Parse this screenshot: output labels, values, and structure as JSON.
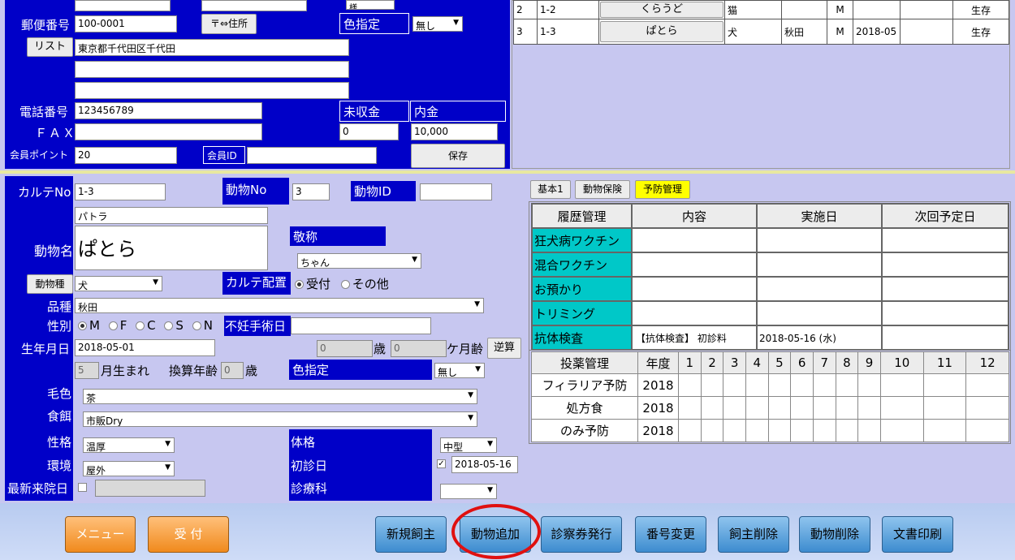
{
  "owner": {
    "postal_label": "郵便番号",
    "postal_value": "100-0001",
    "postal_to_address_button": "〒⇔住所",
    "color_label": "色指定",
    "color_value": "無し",
    "honorific_value_top": "様",
    "list_button": "リスト",
    "address1": "東京都千代田区千代田",
    "address2": "",
    "address3": "",
    "phone_label": "電話番号",
    "phone_value": "123456789",
    "fax_label": "ＦＡＸ",
    "fax_value": "",
    "unpaid_label": "未収金",
    "unpaid_value": "0",
    "deposit_label": "内金",
    "deposit_value": "10,000",
    "points_label": "会員ポイント",
    "points_value": "20",
    "member_id_label": "会員ID",
    "member_id_value": "",
    "save_button": "保存"
  },
  "animal_list": {
    "rows": [
      {
        "num": "2",
        "chart": "1-2",
        "name": "くらうど",
        "species": "猫",
        "breed": "",
        "sex": "M",
        "birth": "",
        "extra": "",
        "status": "生存"
      },
      {
        "num": "3",
        "chart": "1-3",
        "name": "ぱとら",
        "species": "犬",
        "breed": "秋田",
        "sex": "M",
        "birth": "2018-05",
        "extra": "",
        "status": "生存"
      }
    ]
  },
  "animal": {
    "chart_no_label": "カルテNo",
    "chart_no_value": "1-3",
    "animal_no_label": "動物No",
    "animal_no_value": "3",
    "animal_id_label": "動物ID",
    "animal_id_value": "",
    "kana_value": "パトラ",
    "name_label": "動物名",
    "name_value": "ぱとら",
    "honorific_label": "敬称",
    "honorific_value": "ちゃん",
    "species_button": "動物種",
    "species_value": "犬",
    "chart_placement_label": "カルテ配置",
    "placement_options": [
      "受付",
      "その他"
    ],
    "breed_label": "品種",
    "breed_value": "秋田",
    "sex_label": "性別",
    "sex_options": [
      "M",
      "F",
      "C",
      "S",
      "N"
    ],
    "neuter_label": "不妊手術日",
    "neuter_value": "",
    "birth_label": "生年月日",
    "birth_value": "2018-05-01",
    "age_years": "0",
    "age_years_unit": "歳",
    "age_months": "0",
    "age_months_unit": "ケ月齢",
    "calc_button": "逆算",
    "birth_month": "5",
    "birth_month_suffix": "月生まれ",
    "converted_age_label": "換算年齢",
    "converted_age": "0",
    "converted_age_unit": "歳",
    "color_label": "色指定",
    "color_value": "無し",
    "coat_label": "毛色",
    "coat_value": "茶",
    "food_label": "食餌",
    "food_value": "市販Dry",
    "temper_label": "性格",
    "temper_value": "温厚",
    "env_label": "環境",
    "env_value": "屋外",
    "last_visit_label": "最新来院日",
    "last_visit_value": "",
    "build_label": "体格",
    "build_value": "中型",
    "first_visit_label": "初診日",
    "first_visit_value": "2018-05-16",
    "dept_label": "診療科",
    "dept_value": ""
  },
  "tabs": [
    "基本1",
    "動物保険",
    "予防管理"
  ],
  "history": {
    "headers": [
      "履歴管理",
      "内容",
      "実施日",
      "次回予定日"
    ],
    "rows": [
      {
        "name": "狂犬病ワクチン",
        "content": "",
        "date": "",
        "next": ""
      },
      {
        "name": "混合ワクチン",
        "content": "",
        "date": "",
        "next": ""
      },
      {
        "name": "お預かり",
        "content": "",
        "date": "",
        "next": ""
      },
      {
        "name": "トリミング",
        "content": "",
        "date": "",
        "next": ""
      },
      {
        "name": "抗体検査",
        "content": "【抗体検査】 初診料",
        "date": "2018-05-16 (水)",
        "next": ""
      }
    ]
  },
  "medication": {
    "headers": [
      "投薬管理",
      "年度",
      "1",
      "2",
      "3",
      "4",
      "5",
      "6",
      "7",
      "8",
      "9",
      "10",
      "11",
      "12"
    ],
    "rows": [
      {
        "name": "フィラリア予防",
        "year": "2018"
      },
      {
        "name": "処方食",
        "year": "2018"
      },
      {
        "name": "のみ予防",
        "year": "2018"
      }
    ]
  },
  "bottom_buttons": {
    "menu": "メニュー",
    "reception": "受 付",
    "new_owner": "新規飼主",
    "add_animal": "動物追加",
    "issue_ticket": "診察券発行",
    "change_number": "番号変更",
    "delete_owner": "飼主削除",
    "delete_animal": "動物削除",
    "print_docs": "文書印刷"
  },
  "colors": {
    "panel_blue": "#0000c8",
    "cyan_cell": "#00c8c8",
    "highlight_ring": "#e01010",
    "active_tab": "#ffff00"
  }
}
